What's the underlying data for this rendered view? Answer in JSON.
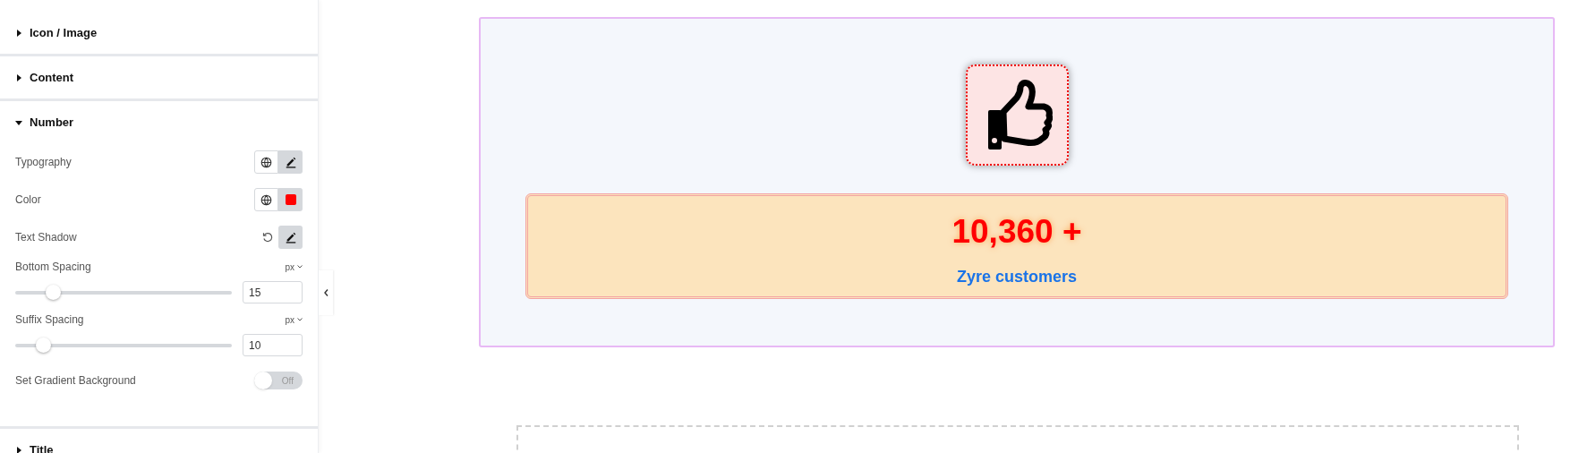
{
  "sections": [
    {
      "title": "Icon / Image",
      "expanded": false
    },
    {
      "title": "Content",
      "expanded": false
    },
    {
      "title": "Number",
      "expanded": true
    },
    {
      "title": "Title",
      "expanded": false
    }
  ],
  "controls": [
    {
      "kind": "buttons",
      "label": "Typography"
    },
    {
      "kind": "buttons",
      "label": "Color",
      "color": "#ff0000"
    },
    {
      "kind": "reset",
      "label": "Text Shadow"
    },
    {
      "kind": "slider",
      "label": "Bottom Spacing",
      "unit": "px",
      "level": 0.15,
      "value": "15"
    },
    {
      "kind": "slider",
      "label": "Suffix Spacing",
      "unit": "px",
      "level": 0.1,
      "value": "10"
    },
    {
      "kind": "switch",
      "label": "Set Gradient Background",
      "on": false,
      "state_text": "Off"
    }
  ],
  "counter": {
    "number": "10,360 +",
    "title": "Zyre customers"
  }
}
